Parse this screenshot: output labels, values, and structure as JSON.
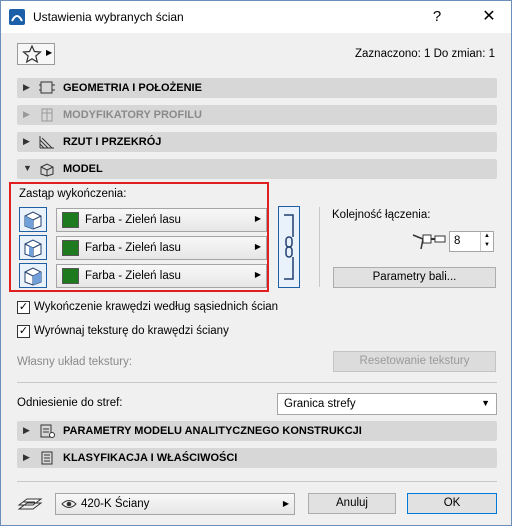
{
  "window": {
    "title": "Ustawienia wybranych ścian",
    "help": "?",
    "close": "✕"
  },
  "header": {
    "selected_info": "Zaznaczono: 1 Do zmian: 1"
  },
  "sections": {
    "geometry": "GEOMETRIA I POŁOŻENIE",
    "profile": "MODYFIKATORY PROFILU",
    "plan": "RZUT I PRZEKRÓJ",
    "model": "MODEL",
    "analytical": "PARAMETRY MODELU ANALITYCZNEGO KONSTRUKCJI",
    "classification": "KLASYFIKACJA I WŁAŚCIWOŚCI"
  },
  "model": {
    "override_label": "Zastąp wykończenia:",
    "surfaces": [
      {
        "label": "Farba - Zieleń lasu",
        "color": "#1e7a1e"
      },
      {
        "label": "Farba - Zieleń lasu",
        "color": "#1e7a1e"
      },
      {
        "label": "Farba - Zieleń lasu",
        "color": "#1e7a1e"
      }
    ],
    "join_order_label": "Kolejność łączenia:",
    "join_order_value": "8",
    "parameters_button": "Parametry bali...",
    "edge_check": {
      "checked": true,
      "label": "Wykończenie krawędzi według sąsiednich ścian"
    },
    "texture_check": {
      "checked": true,
      "label": "Wyrównaj teksturę do krawędzi ściany"
    },
    "custom_texture_label": "Własny układ tekstury:",
    "reset_texture_button": "Resetowanie tekstury",
    "zone_label": "Odniesienie do stref:",
    "zone_value": "Granica strefy"
  },
  "footer": {
    "layer": "420-K Ściany",
    "cancel": "Anuluj",
    "ok": "OK"
  }
}
